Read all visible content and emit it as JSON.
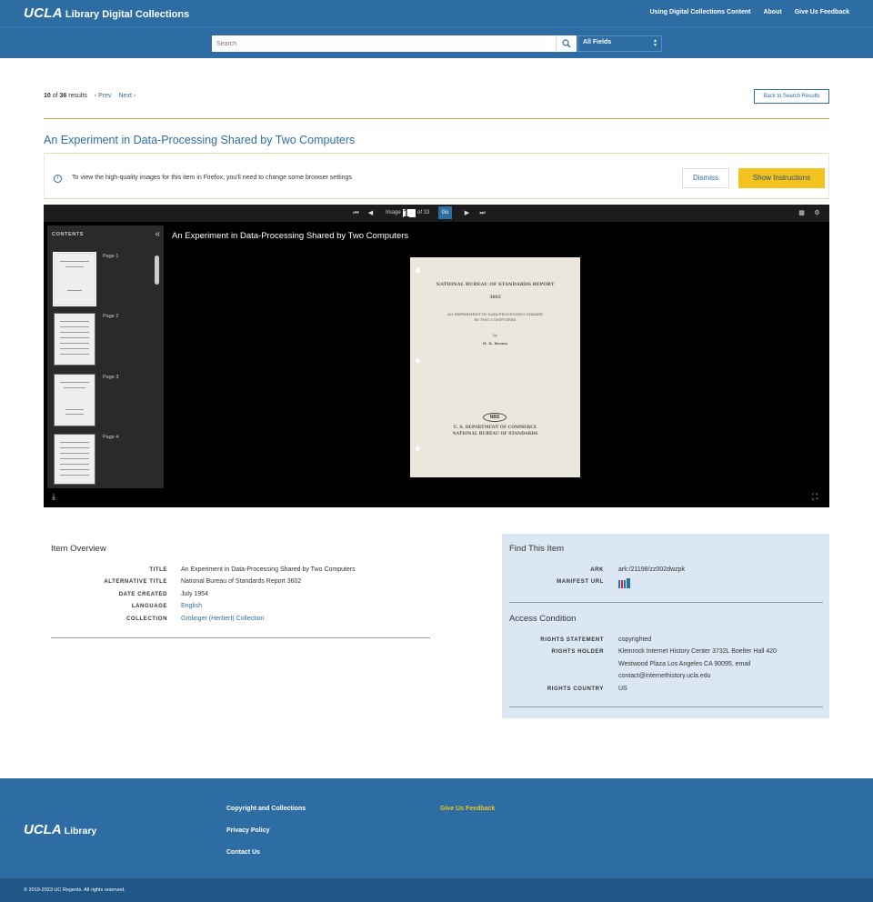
{
  "header": {
    "logo_ucla": "UCLA",
    "logo_library": "Library Digital Collections",
    "nav": [
      "Using Digital Collections Content",
      "About",
      "Give Us Feedback"
    ],
    "search_placeholder": "Search",
    "field_select": "All Fields"
  },
  "results_nav": {
    "current": "10",
    "of": "of",
    "total": "36",
    "results_label": "results",
    "prev": "‹ Prev",
    "next": "Next ›",
    "back": "Back to Search Results"
  },
  "item_title": "An Experiment in Data-Processing Shared by Two Computers",
  "alert": {
    "text": "To view the high-quality images for this item in Firefox, you'll need to change some browser settings",
    "dismiss": "Dismiss",
    "show": "Show Instructions"
  },
  "viewer": {
    "image_label": "Image",
    "image_value": "1",
    "of_label": "of 33",
    "go": "Go",
    "contents_label": "CONTENTS",
    "canvas_title": "An Experiment in Data-Processing Shared by Two Computers",
    "thumbnails": [
      "Page 1",
      "Page 2",
      "Page 3",
      "Page 4"
    ],
    "doc": {
      "line1": "NATIONAL BUREAU OF STANDARDS REPORT",
      "line2": "3602",
      "line3": "AN EXPERIMENT IN DATA-PROCESSING SHARED",
      "line4": "BY TWO COMPUTERS",
      "line5": "by",
      "line6": "H. K. Brown",
      "logo": "NBS",
      "line7": "U. S. DEPARTMENT OF COMMERCE",
      "line8": "NATIONAL BUREAU OF STANDARDS"
    }
  },
  "overview": {
    "heading": "Item Overview",
    "rows": [
      {
        "label": "TITLE",
        "value": "An Experiment in Data-Processing Shared by Two Computers"
      },
      {
        "label": "ALTERNATIVE TITLE",
        "value": "National Bureau of Standards Report 3602"
      },
      {
        "label": "DATE CREATED",
        "value": "July 1954"
      },
      {
        "label": "LANGUAGE",
        "value": "English"
      },
      {
        "label": "COLLECTION",
        "value": "Grolinger (Herbert) Collection"
      }
    ]
  },
  "find": {
    "heading": "Find This Item",
    "ark_label": "ARK",
    "ark_value": "ark:/21198/zz002dwzpk",
    "manifest_label": "MANIFEST URL",
    "access_heading": "Access Condition",
    "rights_statement_label": "RIGHTS STATEMENT",
    "rights_statement_value": "copyrighted",
    "rights_holder_label": "RIGHTS HOLDER",
    "rights_holder_line1": "Kleinrock Internet History Center 3732L Boelter Hall 420",
    "rights_holder_line2": "Westwood Plaza Los Angeles CA 90095, email",
    "rights_holder_line3": "contact@internethistory.ucla.edu",
    "rights_country_label": "RIGHTS COUNTRY",
    "rights_country_value": "US"
  },
  "footer": {
    "logo_ucla": "UCLA",
    "logo_library": "Library",
    "links": [
      "Copyright and Collections",
      "Privacy Policy",
      "Contact Us"
    ],
    "feedback": "Give Us Feedback",
    "copyright": "© 2019-2023 UC Regents. All rights reserved."
  },
  "colors": {
    "brand_blue": "#2d6da4",
    "accent_gold": "#f2c31f"
  }
}
